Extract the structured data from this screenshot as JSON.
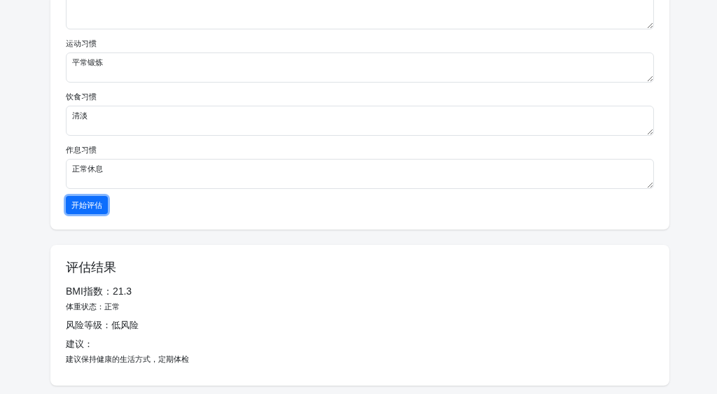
{
  "habits_form": {
    "fields": [
      {
        "label": "运动习惯",
        "value": "平常锻炼"
      },
      {
        "label": "饮食习惯",
        "value": "清淡"
      },
      {
        "label": "作息习惯",
        "value": "正常休息"
      }
    ],
    "submit_button": "开始评估"
  },
  "result": {
    "title": "评估结果",
    "bmi": "BMI指数：21.3",
    "weight_status": "体重状态：正常",
    "risk_level": "风险等级：低风险",
    "advice_label": "建议：",
    "advice": "建议保持健康的生活方式，定期体检"
  }
}
